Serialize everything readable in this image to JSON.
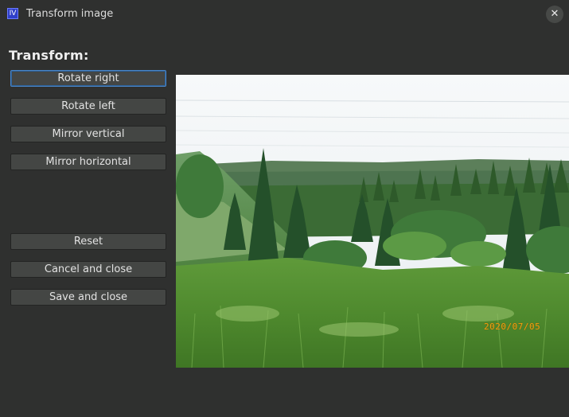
{
  "window": {
    "app_icon_text": "IV",
    "title": "Transform image",
    "close_glyph": "✕"
  },
  "panel": {
    "heading": "Transform:",
    "buttons": {
      "rotate_right": "Rotate right",
      "rotate_left": "Rotate left",
      "mirror_vertical": "Mirror vertical",
      "mirror_horizontal": "Mirror horizontal",
      "reset": "Reset",
      "cancel_close": "Cancel and close",
      "save_close": "Save and close"
    }
  },
  "preview": {
    "date_stamp": "2020/07/05"
  },
  "colors": {
    "background": "#2f302f",
    "button": "#444644",
    "focus_ring": "#4a86c8",
    "date_stamp": "#f0a010"
  },
  "icons": {
    "app": "app-icon",
    "close": "close-icon"
  }
}
